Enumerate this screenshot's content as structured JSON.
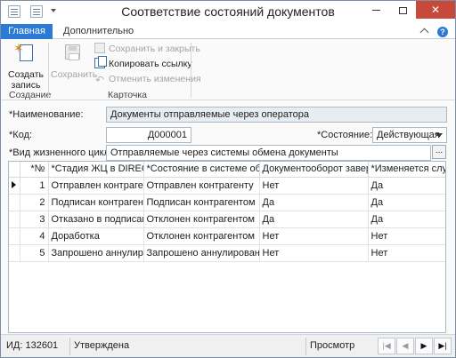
{
  "window": {
    "title": "Соответствие состояний документов",
    "close_glyph": "✕"
  },
  "ribbon": {
    "tabs": [
      {
        "label": "Главная",
        "active": true
      },
      {
        "label": "Дополнительно",
        "active": false
      }
    ],
    "groups": {
      "create": {
        "label": "Создание",
        "create_record": "Создать\nзапись"
      },
      "card": {
        "label": "Карточка",
        "save": "Сохранить",
        "save_close": "Сохранить и закрыть",
        "copy_link": "Копировать ссылку",
        "undo": "Отменить изменения"
      }
    }
  },
  "form": {
    "name_label": "*Наименование:",
    "name_value": "Документы отправляемые через оператора",
    "code_label": "*Код:",
    "code_value": "Д000001",
    "state_label": "*Состояние:",
    "state_value": "Действующая",
    "lifecycle_label": "*Вид жизненного цикла:",
    "lifecycle_value": "Отправляемые через системы обмена документы",
    "ellipsis": "..."
  },
  "grid": {
    "columns": [
      "*№",
      "*Стадия ЖЦ в DIRECTUM",
      "*Состояние в системе обмена",
      "Документооборот завершен",
      "*Изменяется службой"
    ],
    "rows": [
      {
        "n": "1",
        "stage": "Отправлен контрагенту",
        "state": "Отправлен контрагенту",
        "done": "Нет",
        "service": "Да",
        "selected": true
      },
      {
        "n": "2",
        "stage": "Подписан контрагентом",
        "state": "Подписан контрагентом",
        "done": "Да",
        "service": "Да",
        "selected": false
      },
      {
        "n": "3",
        "stage": "Отказано в подписании",
        "state": "Отклонен контрагентом",
        "done": "Да",
        "service": "Да",
        "selected": false
      },
      {
        "n": "4",
        "stage": "Доработка",
        "state": "Отклонен контрагентом",
        "done": "Нет",
        "service": "Нет",
        "selected": false
      },
      {
        "n": "5",
        "stage": "Запрошено аннулирование",
        "state": "Запрошено аннулирование",
        "done": "Нет",
        "service": "Нет",
        "selected": false
      }
    ]
  },
  "status": {
    "id": "ИД: 132601",
    "approval": "Утверждена",
    "mode": "Просмотр",
    "nav": {
      "first": "|◀",
      "prev": "◀",
      "next": "▶",
      "last": "▶|"
    }
  }
}
